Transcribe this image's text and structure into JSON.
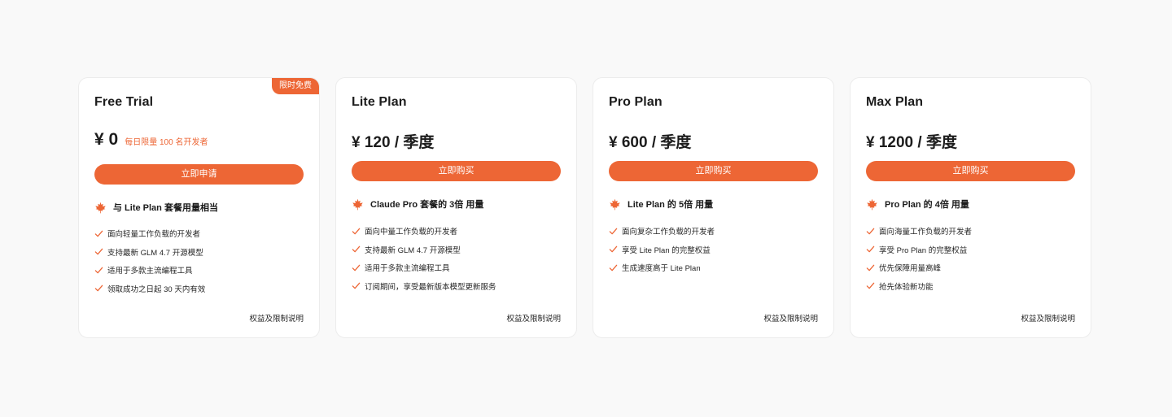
{
  "accent": "#ed6635",
  "plans": [
    {
      "name": "Free Trial",
      "badge": "限时免费",
      "price": "¥ 0",
      "price_note": "每日限量 100 名开发者",
      "cta": "立即申请",
      "highlight_icon": "maple-leaf-icon",
      "highlight": "与 Lite Plan 套餐用量相当",
      "features": [
        "面向轻量工作负载的开发者",
        "支持最新 GLM 4.7 开源模型",
        "适用于多款主流编程工具",
        "领取成功之日起 30 天内有效"
      ],
      "terms": "权益及限制说明"
    },
    {
      "name": "Lite Plan",
      "price": "¥ 120 / 季度",
      "cta": "立即购买",
      "highlight_icon": "maple-leaf-icon",
      "highlight": "Claude Pro 套餐的 3倍 用量",
      "features": [
        "面向中量工作负载的开发者",
        "支持最新 GLM 4.7 开源模型",
        "适用于多款主流编程工具",
        "订阅期间，享受最新版本模型更新服务"
      ],
      "terms": "权益及限制说明"
    },
    {
      "name": "Pro Plan",
      "price": "¥ 600 / 季度",
      "cta": "立即购买",
      "highlight_icon": "maple-leaf-icon",
      "highlight": "Lite Plan 的 5倍 用量",
      "features": [
        "面向复杂工作负载的开发者",
        "享受 Lite Plan 的完整权益",
        "生成速度高于 Lite Plan"
      ],
      "terms": "权益及限制说明"
    },
    {
      "name": "Max Plan",
      "price": "¥ 1200 / 季度",
      "cta": "立即购买",
      "highlight_icon": "maple-leaf-icon",
      "highlight": "Pro Plan 的 4倍 用量",
      "features": [
        "面向海量工作负载的开发者",
        "享受 Pro Plan 的完整权益",
        "优先保障用量高峰",
        "抢先体验新功能"
      ],
      "terms": "权益及限制说明"
    }
  ]
}
